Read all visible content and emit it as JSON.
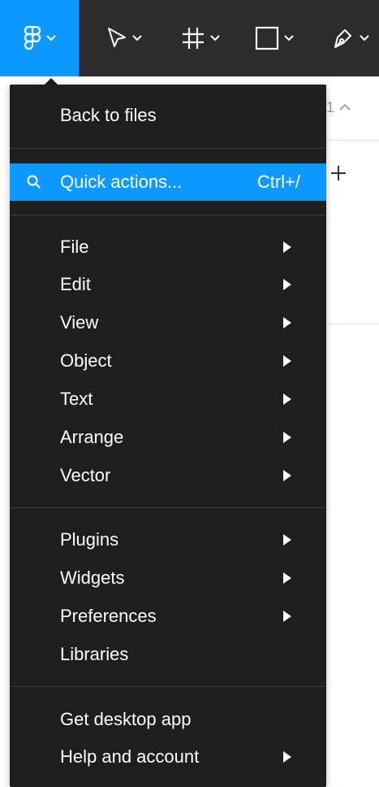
{
  "toolbar": {
    "tools": [
      {
        "icon": "figma-logo-icon",
        "caret": "chevron-down-icon"
      },
      {
        "icon": "move-cursor-icon",
        "caret": "chevron-down-icon"
      },
      {
        "icon": "frame-hash-icon",
        "caret": "chevron-down-icon"
      },
      {
        "icon": "rectangle-icon",
        "caret": "chevron-down-icon"
      },
      {
        "icon": "pen-icon",
        "caret": "chevron-down-icon"
      }
    ]
  },
  "background": {
    "page_indicator": "1",
    "add_icon": "plus-icon"
  },
  "menu": {
    "back_to_files": "Back to files",
    "quick_actions": {
      "label": "Quick actions...",
      "shortcut": "Ctrl+/"
    },
    "group1": [
      "File",
      "Edit",
      "View",
      "Object",
      "Text",
      "Arrange",
      "Vector"
    ],
    "group2": [
      "Plugins",
      "Widgets",
      "Preferences",
      "Libraries"
    ],
    "group3": [
      "Get desktop app",
      "Help and account"
    ]
  },
  "colors": {
    "accent": "#0d99ff",
    "toolbar_bg": "#2c2c2c",
    "menu_bg": "#1e1e1e"
  }
}
